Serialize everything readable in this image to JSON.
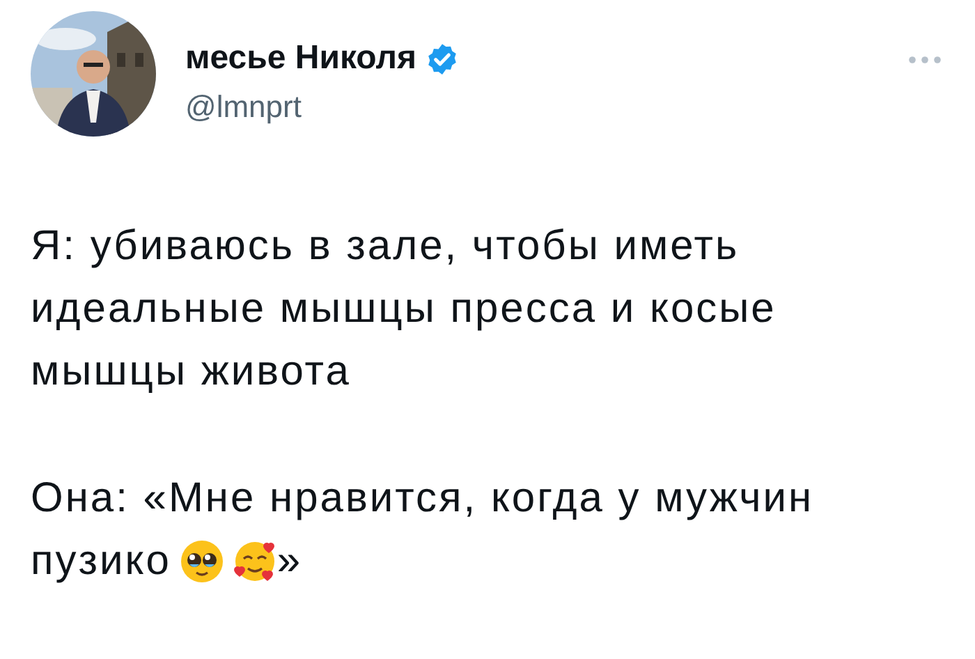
{
  "author": {
    "name": "месье Николя",
    "verified": true,
    "handle": "@lmnprt"
  },
  "paragraphs": [
    "Я: убиваюсь в зале, чтобы иметь идеальные мышцы пресса и косые мышцы живота"
  ],
  "reply_lines": [
    "Она: «Мне нравится, когда у мужчин",
    "пузико"
  ],
  "closing": "»"
}
